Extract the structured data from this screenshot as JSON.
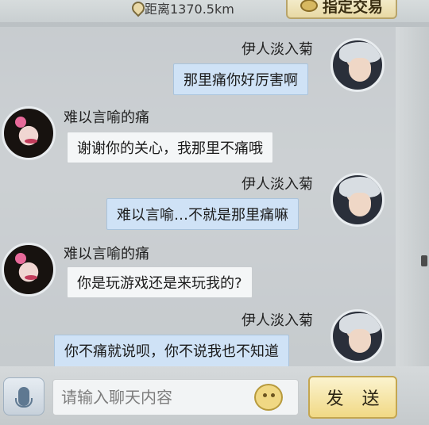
{
  "header": {
    "distance_text": "距离1370.5km",
    "trade_button_label": "指定交易"
  },
  "messages": [
    {
      "sender": "伊人淡入菊",
      "side": "right",
      "avatar": "male-avatar",
      "text": "那里痛你好厉害啊"
    },
    {
      "sender": "难以言喻的痛",
      "side": "left",
      "avatar": "female-avatar",
      "text": "谢谢你的关心，我那里不痛哦"
    },
    {
      "sender": "伊人淡入菊",
      "side": "right",
      "avatar": "male-avatar",
      "text": "难以言喻…不就是那里痛嘛"
    },
    {
      "sender": "难以言喻的痛",
      "side": "left",
      "avatar": "female-avatar",
      "text": "你是玩游戏还是来玩我的?"
    },
    {
      "sender": "伊人淡入菊",
      "side": "right",
      "avatar": "male-avatar",
      "text": "你不痛就说呗，你不说我也不知道"
    }
  ],
  "input": {
    "placeholder": "请输入聊天内容",
    "value": ""
  },
  "buttons": {
    "send_label": "发 送"
  },
  "icons": {
    "location": "location-pin-icon",
    "trade": "trade-icon",
    "voice": "microphone-icon",
    "emoji": "emoji-icon"
  },
  "colors": {
    "self_bubble": "#cfe2f6",
    "other_bubble": "#f4f6f7",
    "send_button": "#f1d985"
  }
}
